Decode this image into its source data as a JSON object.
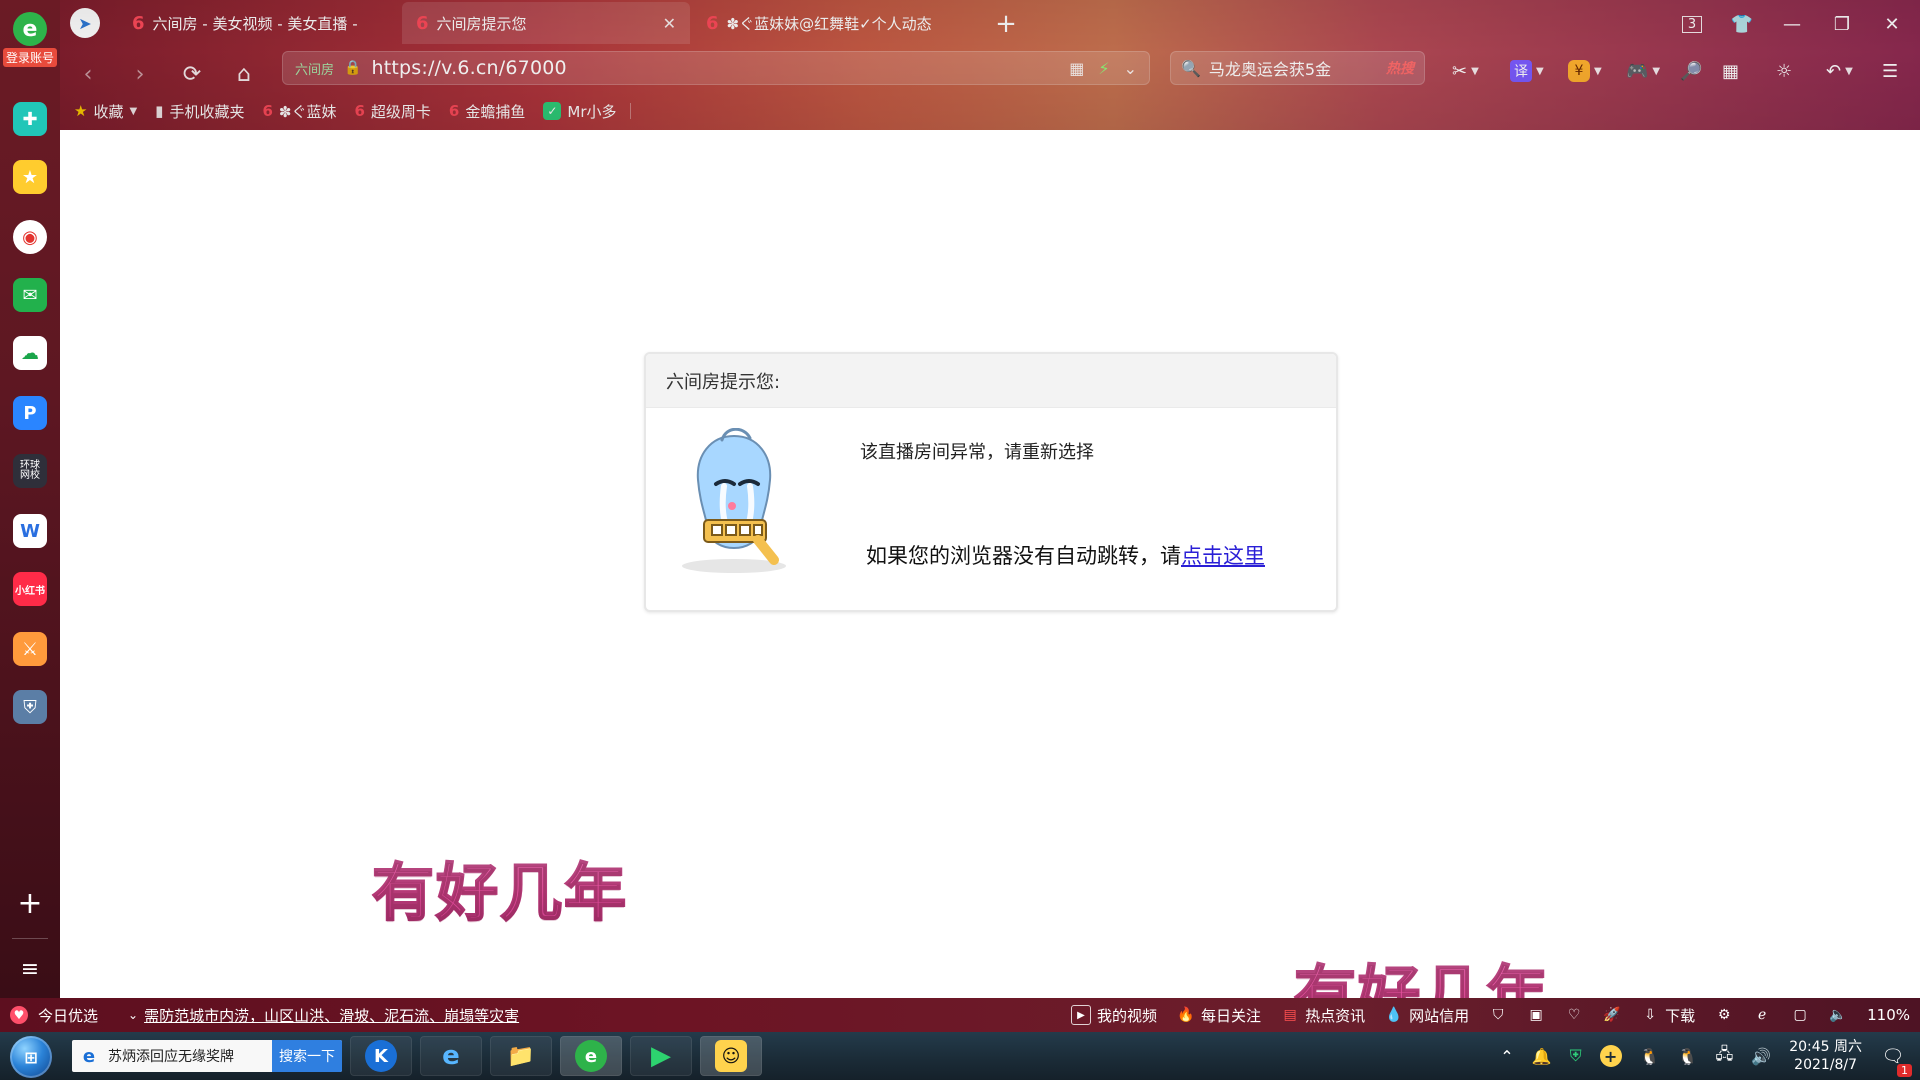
{
  "browser": {
    "tabs": [
      {
        "title": "六间房 - 美女视频 - 美女直播 -",
        "active": false
      },
      {
        "title": "六间房提示您",
        "active": true
      },
      {
        "title": "✽ぐ蓝妹妹@红舞鞋✓个人动态",
        "active": false
      }
    ],
    "tab_count": "3",
    "address": {
      "site_label": "六间房",
      "url": "https://v.6.cn/67000"
    },
    "search": {
      "query": "马龙奥运会获5金",
      "hot_label": "热搜"
    },
    "bookmarks": [
      {
        "label": "收藏"
      },
      {
        "label": "手机收藏夹"
      },
      {
        "label": "✽ぐ蓝妹"
      },
      {
        "label": "超级周卡"
      },
      {
        "label": "金蟾捕鱼"
      },
      {
        "label": "Mr小多"
      }
    ],
    "toolbar": {
      "translate_label": "译"
    }
  },
  "sidebar": {
    "login_label": "登录账号",
    "items": [
      {
        "icon": "puzzle-icon"
      },
      {
        "icon": "star-icon"
      },
      {
        "icon": "weibo-icon"
      },
      {
        "icon": "mail-icon"
      },
      {
        "icon": "cloud-icon"
      },
      {
        "icon": "p-app-icon"
      },
      {
        "icon": "news-icon",
        "label": "环球\n网校"
      },
      {
        "icon": "document-icon"
      },
      {
        "icon": "xiaohongshu-icon",
        "label": "小红书"
      },
      {
        "icon": "game-icon"
      },
      {
        "icon": "pubg-icon"
      }
    ]
  },
  "dialog": {
    "title": "六间房提示您:",
    "message": "该直播房间异常，请重新选择",
    "redirect_prefix": "如果您的浏览器没有自动跳转，请",
    "redirect_link": "点击这里"
  },
  "overlays": {
    "subtitle_1": "有好几年",
    "subtitle_2": "有好几年"
  },
  "statusbar": {
    "today_label": "今日优选",
    "news": "需防范城市内涝，山区山洪、滑坡、泥石流、崩塌等灾害",
    "items": [
      {
        "label": "我的视频"
      },
      {
        "label": "每日关注"
      },
      {
        "label": "热点资讯"
      },
      {
        "label": "网站信用"
      },
      {
        "label": "下载"
      }
    ],
    "zoom": "110%"
  },
  "taskbar": {
    "search_query": "苏炳添回应无缘奖牌",
    "search_button": "搜索一下",
    "time": "20:45 周六",
    "date": "2021/8/7",
    "notification_count": "1"
  },
  "colors": {
    "accent_red": "#b0343c",
    "link_blue": "#2a1fd6",
    "overlay_pink": "#ff5fb4"
  }
}
